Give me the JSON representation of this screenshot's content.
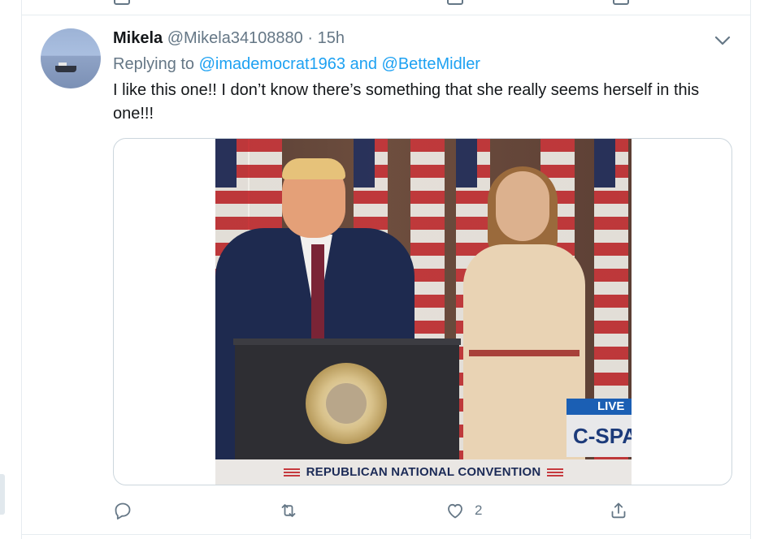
{
  "tweet": {
    "display_name": "Mikela",
    "handle": "@Mikela34108880",
    "separator": "·",
    "time": "15h",
    "replying_prefix": "Replying to",
    "reply_mention_1": "@imademocrat1963",
    "reply_conjunction": "and",
    "reply_mention_2": "@BetteMidler",
    "text": "I like this one!!  I don’t know there’s something that she really seems herself in this one!!!",
    "media": {
      "banner_text": "REPUBLICAN NATIONAL CONVENTION",
      "live_label": "LIVE",
      "network_label": "C-SPAN"
    },
    "actions": {
      "reply_icon": "reply-icon",
      "retweet_icon": "retweet-icon",
      "like_icon": "like-icon",
      "like_count": "2",
      "share_icon": "share-icon"
    }
  },
  "colors": {
    "text_primary": "#14171a",
    "text_secondary": "#657786",
    "link_blue": "#1da1f2",
    "border": "#e6ecf0"
  }
}
